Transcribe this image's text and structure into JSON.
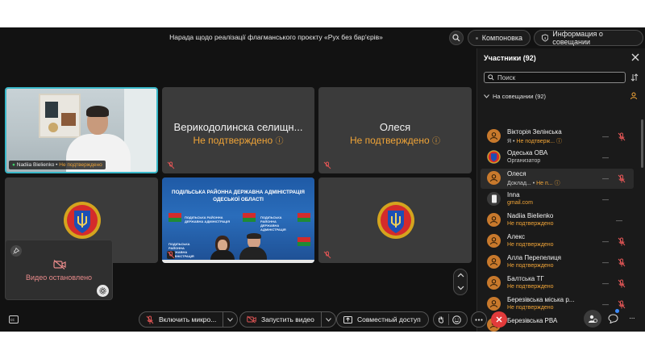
{
  "header": {
    "title": "Нарада щодо реалізації флагманського проєкту «Рух без бар'єрів»",
    "layout_label": "Компоновка",
    "info_label": "Информация о совещании"
  },
  "tiles": {
    "self": {
      "name": "Nadiia Bielienko",
      "status": "Не подтверждено"
    },
    "verykodolynska": {
      "name": "Верикодолинска селищн...",
      "status": "Не подтверждено"
    },
    "olesia": {
      "name": "Олеся",
      "status": "Не подтверждено"
    },
    "conference": {
      "title_line1": "ПОДІЛЬСЬКА РАЙОННА ДЕРЖАВНА АДМІНІСТРАЦІЯ",
      "title_line2": "ОДЕСЬКОЇ ОБЛАСТІ",
      "backdrop_text": "ПОДІЛЬСЬКА РАЙОННА ДЕРЖАВНА АДМІНІСТРАЦІЯ"
    }
  },
  "self_preview": {
    "label": "Видео остановлено"
  },
  "participants": {
    "title": "Участники (92)",
    "search_placeholder": "Поиск",
    "section_label": "На совещании (92)",
    "list": [
      {
        "name": "Вікторія Зелінська",
        "sub_prefix": "Я  •",
        "sub_warn": "Не подтверж...",
        "avatar": "person"
      },
      {
        "name": "Одеська ОВА",
        "sub_prefix": "Организатор",
        "sub_warn": "",
        "avatar": "emblem"
      },
      {
        "name": "Олеся",
        "sub_prefix": "Доклад...  •",
        "sub_warn": "Не п...",
        "avatar": "person"
      },
      {
        "name": "Inna",
        "sub_prefix": "",
        "sub_warn": "gmail.com",
        "avatar": "device"
      },
      {
        "name": "Nadiia Bielienko",
        "sub_prefix": "",
        "sub_warn": "Не подтверждено",
        "avatar": "person"
      },
      {
        "name": "Алекс",
        "sub_prefix": "",
        "sub_warn": "Не подтверждено",
        "avatar": "person"
      },
      {
        "name": "Алла Перепелиця",
        "sub_prefix": "",
        "sub_warn": "Не подтверждено",
        "avatar": "person"
      },
      {
        "name": "Балтська ТГ",
        "sub_prefix": "",
        "sub_warn": "Не подтверждено",
        "avatar": "person"
      },
      {
        "name": "Березівська міська р...",
        "sub_prefix": "",
        "sub_warn": "Не подтверждено",
        "avatar": "person"
      },
      {
        "name": "Березівська РВА",
        "sub_prefix": "",
        "sub_warn": "",
        "avatar": "person"
      }
    ]
  },
  "toolbar": {
    "mic_label": "Включить микро...",
    "video_label": "Запустить видео",
    "share_label": "Совместный доступ"
  },
  "colors": {
    "warning": "#f0a437",
    "end_call": "#e23b3b",
    "active_border": "#39b8c9",
    "avatar": "#c8792c"
  }
}
